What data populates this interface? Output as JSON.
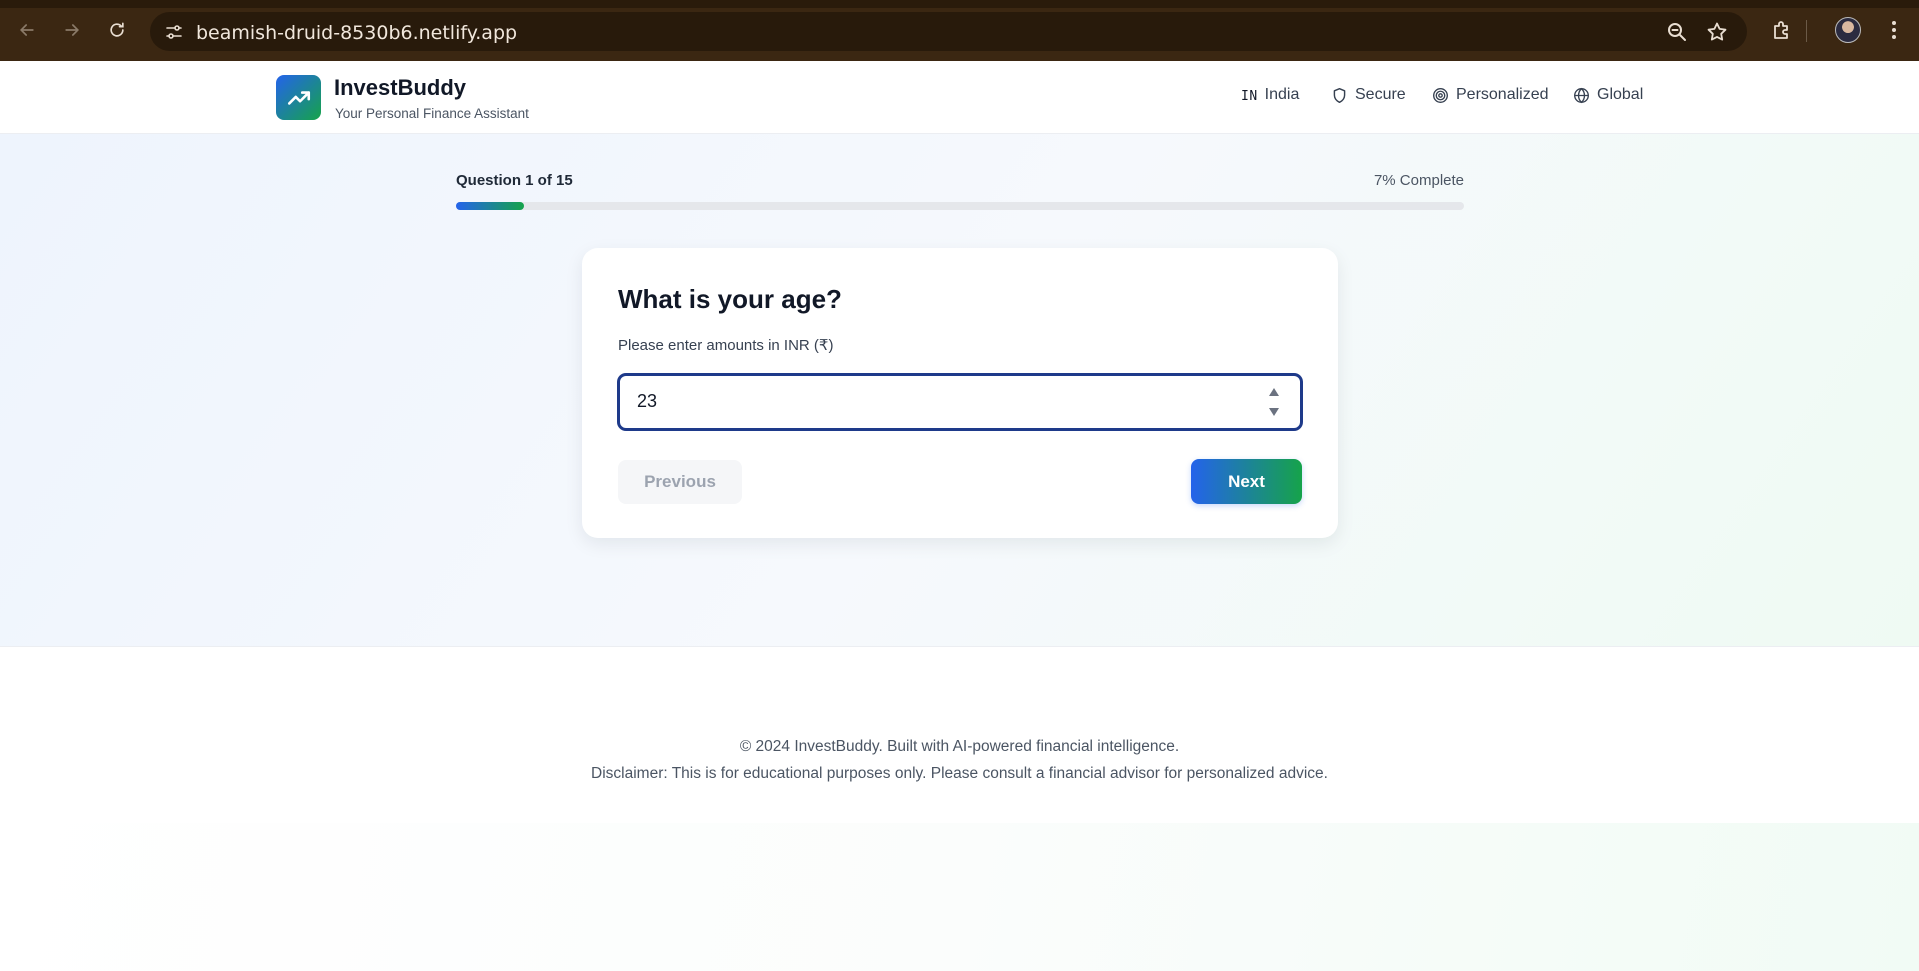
{
  "browser": {
    "url": "beamish-druid-8530b6.netlify.app"
  },
  "header": {
    "brand": "InvestBuddy",
    "tagline": "Your Personal Finance Assistant",
    "country_code": "IN",
    "nav": {
      "country": "India",
      "secure": "Secure",
      "personalized": "Personalized",
      "global": "Global"
    }
  },
  "progress": {
    "question_label": "Question 1 of 15",
    "percent_label": "7% Complete",
    "fraction": 0.067
  },
  "card": {
    "question": "What is your age?",
    "hint": "Please enter amounts in INR (₹)",
    "value": "23",
    "prev_label": "Previous",
    "next_label": "Next"
  },
  "footer": {
    "copyright": "© 2024 InvestBuddy. Built with AI-powered financial intelligence.",
    "disclaimer": "Disclaimer: This is for educational purposes only. Please consult a financial advisor for personalized advice."
  },
  "colors": {
    "brand_blue": "#2463eb",
    "brand_green": "#16a34a",
    "chrome_bg": "#3b2712"
  },
  "icons": [
    "back-arrow-icon",
    "forward-arrow-icon",
    "reload-icon",
    "site-settings-icon",
    "zoom-icon",
    "bookmark-star-icon",
    "extensions-icon",
    "menu-icon",
    "trend-up-icon",
    "shield-icon",
    "target-icon",
    "globe-icon"
  ]
}
